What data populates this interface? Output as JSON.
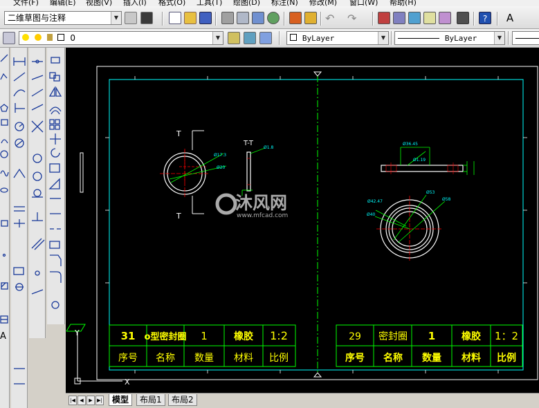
{
  "menu": {
    "items": [
      "文件(F)",
      "编辑(E)",
      "视图(V)",
      "插入(I)",
      "格式(O)",
      "工具(T)",
      "绘图(D)",
      "标注(N)",
      "修改(M)",
      "窗口(W)",
      "帮助(H)"
    ]
  },
  "toolbar": {
    "workspace": "二维草图与注释",
    "layer": "0",
    "color": "ByLayer",
    "linetype": "ByLayer"
  },
  "drawing": {
    "section_label": "T-T",
    "section_mark_left": "T",
    "dims_left": [
      "Ø17.3",
      "Ø20",
      "Ø1.8"
    ],
    "dims_right": [
      "Ø36.45",
      "Ø1.19",
      "Ø53",
      "Ø58",
      "Ø42.47",
      "Ø40"
    ],
    "watermark_cn": "沐风网",
    "watermark_url": "www.mfcad.com",
    "axis_x": "X",
    "axis_y": "Y",
    "table_left": {
      "values": [
        "31",
        "o型密封圈",
        "1",
        "橡胶",
        "1:2"
      ],
      "headers": [
        "序号",
        "名称",
        "数量",
        "材料",
        "比例"
      ]
    },
    "table_right": {
      "values": [
        "29",
        "密封圈",
        "1",
        "橡胶",
        "1：2"
      ],
      "headers": [
        "序号",
        "名称",
        "数量",
        "材料",
        "比例"
      ]
    }
  },
  "tabs": [
    "模型",
    "布局1",
    "布局2"
  ],
  "colors": {
    "background": "#000000",
    "frame": "#ffffff",
    "border": "#00ffff",
    "table_text": "#ffff00",
    "center_line": "#00ff00",
    "hatch": "#ff0000"
  }
}
